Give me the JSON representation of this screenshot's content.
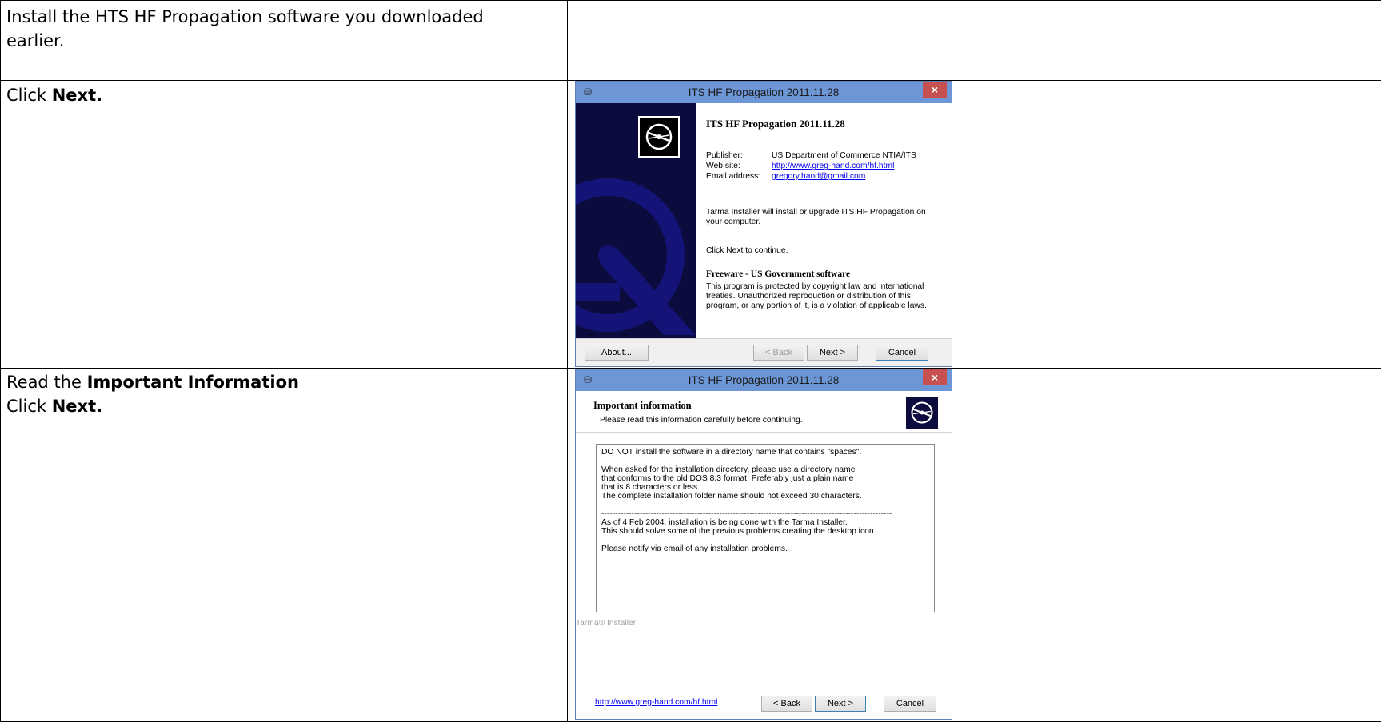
{
  "rows": [
    {
      "instruction": "Install the HTS HF Propagation software you downloaded earlier.",
      "instruction_line1": "Install the HTS HF Propagation software you downloaded",
      "instruction_line2": "earlier."
    },
    {
      "pre": "Click ",
      "bold": "Next."
    },
    {
      "pre1": "Read the ",
      "bold1": "Important Information",
      "pre2": "Click ",
      "bold2": "Next."
    }
  ],
  "dialog1": {
    "title": "ITS HF Propagation 2011.11.28",
    "heading": "ITS HF Propagation 2011.11.28",
    "publisher_label": "Publisher:",
    "publisher_value": "US Department of Commerce NTIA/ITS",
    "website_label": "Web site:",
    "website_value": "http://www.greg-hand.com/hf.html",
    "email_label": "Email address:",
    "email_value": "gregory.hand@gmail.com",
    "intro_line1": "Tarma Installer will install or upgrade ITS HF Propagation on",
    "intro_line2": "your computer.",
    "continue_text": "Click Next to continue.",
    "freeware_heading": "Freeware - US Government software",
    "legal_line1": "This program is protected by copyright law and international",
    "legal_line2": "treaties. Unauthorized reproduction or distribution of this",
    "legal_line3": "program, or any portion of it, is a violation of applicable laws.",
    "about_button": "About...",
    "back_button": "< Back",
    "next_button": "Next >",
    "cancel_button": "Cancel"
  },
  "dialog2": {
    "title": "ITS HF Propagation 2011.11.28",
    "heading": "Important information",
    "subheading": "Please read this information carefully before continuing.",
    "info_lines": [
      "DO NOT install the software in a directory name that contains \"spaces\".",
      "",
      "When asked for the installation directory, please use a directory name",
      "that conforms to the old DOS 8.3 format. Preferably just a plain name",
      "that is 8 characters or less.",
      "The complete installation folder name should not exceed 30 characters.",
      "",
      "----------------------------------------------------------------------------------------------------------",
      "As of 4 Feb 2004, installation is being done with the Tarma Installer.",
      "This should solve some of the previous problems creating the desktop icon.",
      "",
      "Please notify via email of any installation problems."
    ],
    "installer_label": "Tarma® Installer",
    "footer_link": "http://www.greg-hand.com/hf.html",
    "back_button": "< Back",
    "next_button": "Next >",
    "cancel_button": "Cancel"
  },
  "colors": {
    "dialog_title_bar": "#6d96d6",
    "side_panel": "#0b0b3d",
    "close_button": "#c75050",
    "link": "#0000ee"
  },
  "icons": [
    "installer-icon",
    "close-icon",
    "cd-disc-icon"
  ]
}
